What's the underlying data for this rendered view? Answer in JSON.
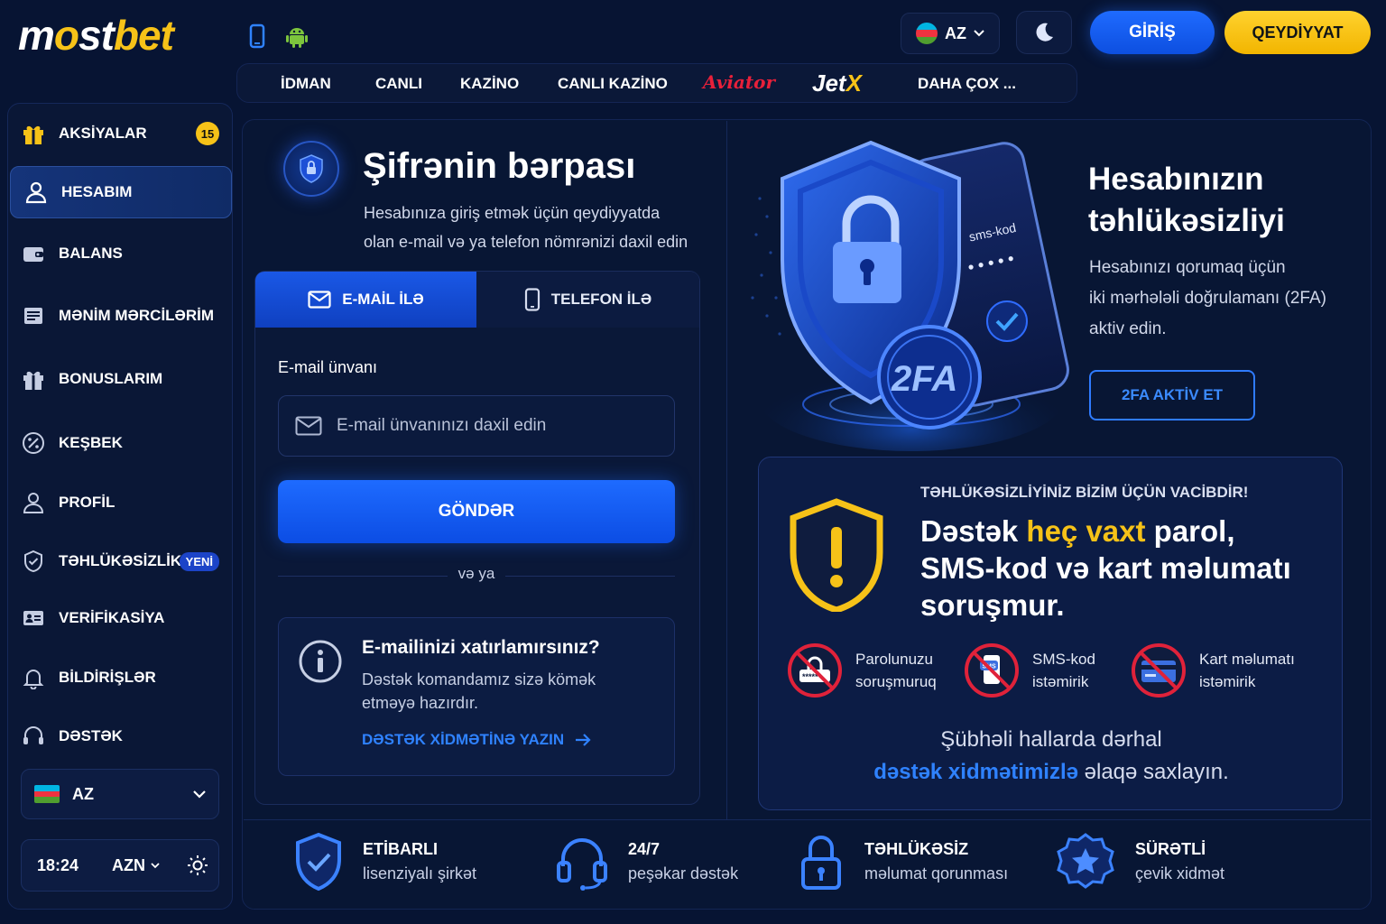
{
  "brand": {
    "logo_a": "m",
    "logo_b": "o",
    "logo_c": "st",
    "logo_d": "bet"
  },
  "header": {
    "language": "AZ",
    "login_label": "GİRİŞ",
    "register_label": "QEYDİYYAT"
  },
  "nav": {
    "items": [
      "İDMAN",
      "CANLI",
      "KAZİNO",
      "CANLI KAZİNO",
      "Aviator",
      "JetX",
      "DAHA ÇOX ..."
    ]
  },
  "sidebar": {
    "items": [
      {
        "label": "AKSİYALAR",
        "badge": "15"
      },
      {
        "label": "HESABIM"
      },
      {
        "label": "BALANS"
      },
      {
        "label": "MƏNİM MƏRCİLƏRİM"
      },
      {
        "label": "BONUSLARIM"
      },
      {
        "label": "KEŞBEK"
      },
      {
        "label": "PROFİL"
      },
      {
        "label": "TƏHLÜKƏSİZLİK",
        "badge": "YENİ"
      },
      {
        "label": "VERİFİKASİYA"
      },
      {
        "label": "BİLDİRİŞLƏR"
      },
      {
        "label": "DƏSTƏK"
      }
    ],
    "language": "AZ",
    "time": "18:24",
    "currency": "AZN"
  },
  "recovery": {
    "title": "Şifrənin bərpası",
    "subtitle_1": "Hesabınıza giriş etmək üçün qeydiyyatda",
    "subtitle_2": "olan e-mail və ya telefon nömrənizi daxil edin",
    "tab_email": "E-MAİL İLƏ",
    "tab_phone": "TELEFON İLƏ",
    "email_label": "E-mail ünvanı",
    "email_placeholder": "E-mail ünvanınızı daxil edin",
    "email_value": "",
    "send_label": "GÖNDƏR",
    "or_label": "və ya",
    "help_title": "E-mailinizi xatırlamırsınız?",
    "help_desc_1": "Dəstək komandamız sizə kömək",
    "help_desc_2": "etməyə hazırdır.",
    "help_link": "DƏSTƏK XİDMƏTİNƏ YAZIN"
  },
  "security": {
    "title_1": "Hesabınızın",
    "title_2": "təhlükəsizliyi",
    "desc_1": "Hesabınızı qorumaq üçün",
    "desc_2": "iki mərhələli doğrulamanı (2FA)",
    "desc_3": "aktiv edin.",
    "button": "2FA AKTİV ET",
    "art_sms": "sms-kod",
    "art_dots": "• • • • •",
    "art_2fa": "2FA"
  },
  "warning": {
    "kicker": "TƏHLÜKƏSİZLİYİNİZ BİZİM ÜÇÜN VACİBDİR!",
    "line1_a": "Dəstək ",
    "line1_b": "heç vaxt",
    "line1_c": " parol,",
    "line2": "SMS-kod və kart məlumatı",
    "line3": "soruşmur.",
    "items": [
      {
        "l1": "Parolunuzu",
        "l2": "soruşmuruq",
        "icon": "no-password-icon"
      },
      {
        "l1": "SMS-kod",
        "l2": "istəmirik",
        "icon": "no-sms-icon"
      },
      {
        "l1": "Kart məlumatı",
        "l2": "istəmirik",
        "icon": "no-card-icon"
      }
    ],
    "foot_1": "Şübhəli hallarda dərhal",
    "foot_link": "dəstək xidmətimizlə",
    "foot_2": " əlaqə saxlayın."
  },
  "features": [
    {
      "t1": "ETİBARLI",
      "t2": "lisenziyalı şirkət"
    },
    {
      "t1": "24/7",
      "t2": "peşəkar dəstək"
    },
    {
      "t1": "TƏHLÜKƏSİZ",
      "t2": "məlumat qorunması"
    },
    {
      "t1": "SÜRƏTLİ",
      "t2": "çevik xidmət"
    }
  ],
  "colors": {
    "accent": "#1e6bff",
    "brand_yellow": "#f6c218",
    "bg": "#071433",
    "danger": "#e0223a"
  }
}
